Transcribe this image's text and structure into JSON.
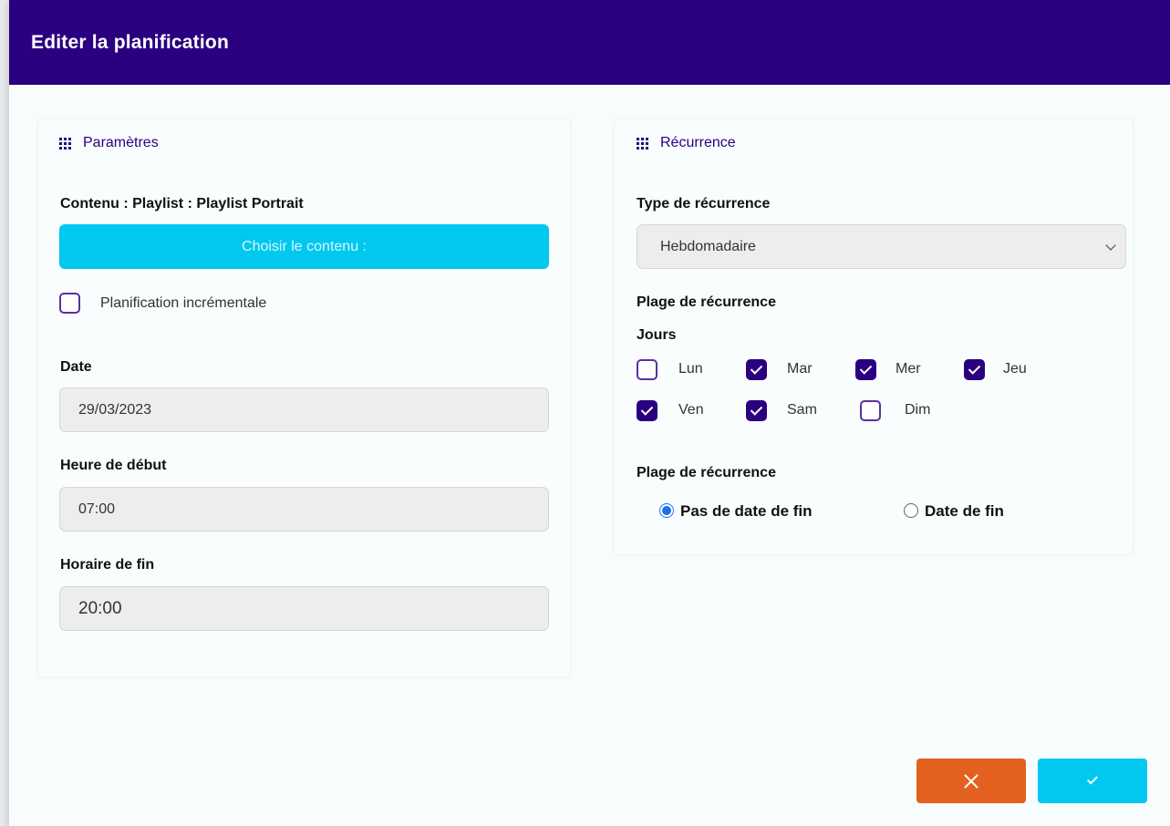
{
  "modal": {
    "title": "Editer la planification"
  },
  "params": {
    "title": "Paramètres",
    "content_label": "Contenu : Playlist : Playlist Portrait",
    "choose_button": "Choisir le contenu :",
    "incremental": {
      "label": "Planification incrémentale",
      "checked": false
    },
    "date": {
      "label": "Date",
      "value": "29/03/2023"
    },
    "start": {
      "label": "Heure de début",
      "value": "07:00"
    },
    "end": {
      "label": "Horaire de fin",
      "value": "20:00"
    }
  },
  "recurrence": {
    "title": "Récurrence",
    "type_label": "Type de récurrence",
    "type_value": "Hebdomadaire",
    "range_label": "Plage de récurrence",
    "days_label": "Jours",
    "days": [
      {
        "label": "Lun",
        "checked": false
      },
      {
        "label": "Mar",
        "checked": true
      },
      {
        "label": "Mer",
        "checked": true
      },
      {
        "label": "Jeu",
        "checked": true
      },
      {
        "label": "Ven",
        "checked": true
      },
      {
        "label": "Sam",
        "checked": true
      },
      {
        "label": "Dim",
        "checked": false
      }
    ],
    "range_label_2": "Plage de récurrence",
    "options": [
      {
        "label": "Pas de date de fin",
        "selected": true
      },
      {
        "label": "Date de fin",
        "selected": false
      }
    ]
  },
  "actions": {
    "cancel_icon": "close-icon",
    "confirm_icon": "check-icon"
  },
  "colors": {
    "header": "#2a0080",
    "accent": "#00c8ef",
    "cancel": "#e4601e"
  }
}
